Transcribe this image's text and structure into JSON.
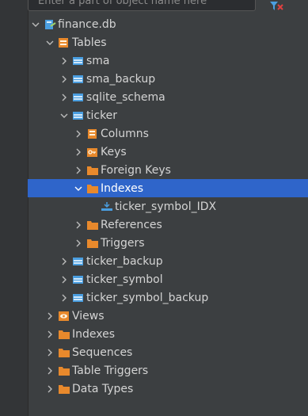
{
  "search": {
    "placeholder": "Enter a part of object name here"
  },
  "colors": {
    "selection": "#2f65ca",
    "folder": "#e8892c",
    "table": "#4a9ee0"
  },
  "tree": {
    "database": "finance.db",
    "tables_label": "Tables",
    "tables": [
      "sma",
      "sma_backup",
      "sqlite_schema"
    ],
    "ticker": {
      "label": "ticker",
      "columns": "Columns",
      "keys": "Keys",
      "foreign_keys": "Foreign Keys",
      "indexes": "Indexes",
      "index_item": "ticker_symbol_IDX",
      "references": "References",
      "triggers": "Triggers"
    },
    "tables_after": [
      "ticker_backup",
      "ticker_symbol",
      "ticker_symbol_backup"
    ],
    "views": "Views",
    "indexes": "Indexes",
    "sequences": "Sequences",
    "table_triggers": "Table Triggers",
    "data_types": "Data Types"
  }
}
